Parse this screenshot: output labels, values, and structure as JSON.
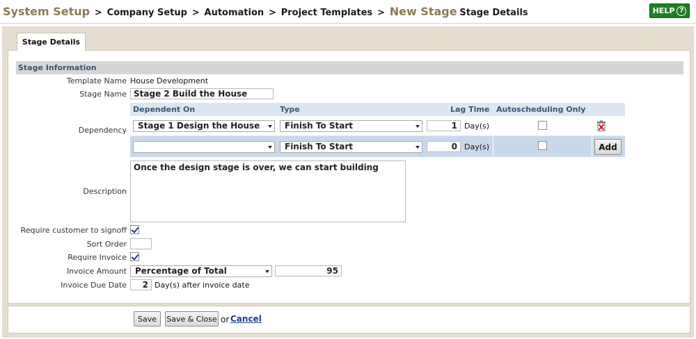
{
  "breadcrumb": {
    "system_setup": "System Setup",
    "sep": ">",
    "company_setup": "Company Setup",
    "automation": "Automation",
    "project_templates": "Project Templates",
    "new_stage": "New Stage",
    "stage_details": "Stage Details"
  },
  "help": {
    "label": "HELP",
    "icon": "?"
  },
  "tab": {
    "label": "Stage Details"
  },
  "section": {
    "title": "Stage Information"
  },
  "form": {
    "template_name_label": "Template Name",
    "template_name_value": "House Development",
    "stage_name_label": "Stage Name",
    "stage_name_value": "Stage 2 Build the House",
    "dependency_label": "Dependency",
    "description_label": "Description",
    "description_value": "Once the design stage is over, we can start building",
    "signoff_label": "Require customer to signoff",
    "signoff_checked": true,
    "sort_order_label": "Sort Order",
    "sort_order_value": "",
    "require_invoice_label": "Require Invoice",
    "require_invoice_checked": true,
    "invoice_amount_label": "Invoice Amount",
    "invoice_amount_type": "Percentage of Total",
    "invoice_amount_value": "95",
    "invoice_due_label": "Invoice Due Date",
    "invoice_due_value": "2",
    "invoice_due_suffix": "Day(s) after invoice date"
  },
  "dependency": {
    "headers": {
      "dependent_on": "Dependent On",
      "type": "Type",
      "lag_time": "Lag Time",
      "autoscheduling": "Autoscheduling Only"
    },
    "rows": [
      {
        "dependent_on": "Stage 1 Design the House",
        "type": "Finish To Start",
        "lag": "1",
        "unit": "Day(s)",
        "auto": false
      },
      {
        "dependent_on": "",
        "type": "Finish To Start",
        "lag": "0",
        "unit": "Day(s)",
        "auto": false
      }
    ],
    "add_label": "Add"
  },
  "footer": {
    "save_label": "Save",
    "save_close_label": "Save & Close",
    "or_text": "or",
    "cancel_label": "Cancel"
  },
  "colors": {
    "header_brand": "#8b7a55",
    "help_green": "#1e7f24",
    "section_text": "#3b5574",
    "row_highlight": "#c9d9ec"
  }
}
